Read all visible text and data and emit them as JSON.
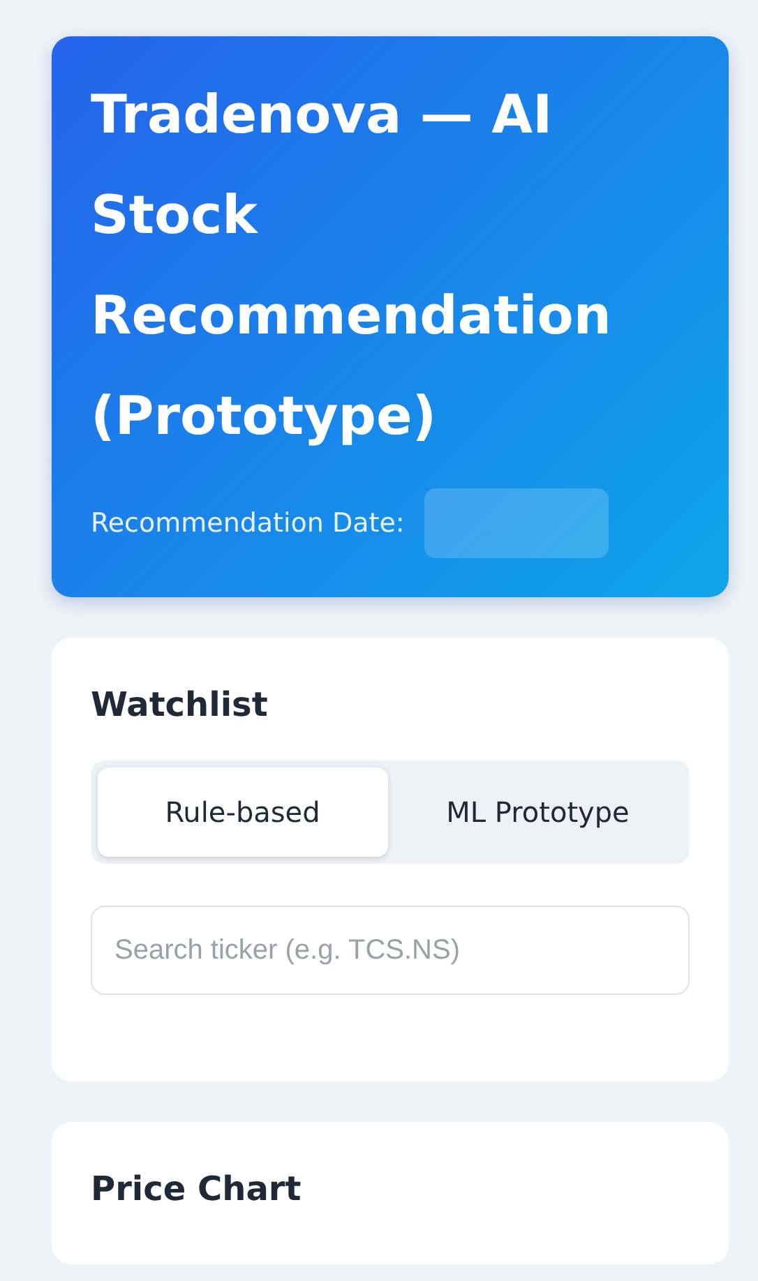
{
  "header": {
    "title": "Tradenova — AI Stock Recommendation (Prototype)",
    "date_label": "Recommendation Date:"
  },
  "watchlist": {
    "title": "Watchlist",
    "tabs": [
      {
        "label": "Rule-based",
        "selected": true
      },
      {
        "label": "ML Prototype",
        "selected": false
      }
    ],
    "search": {
      "placeholder": "Search ticker (e.g. TCS.NS)"
    }
  },
  "price_chart": {
    "title": "Price Chart"
  }
}
